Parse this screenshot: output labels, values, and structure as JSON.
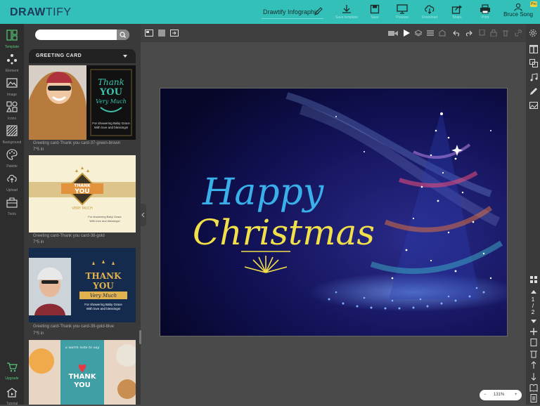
{
  "app": {
    "logo_main": "DRAW",
    "logo_tail": "TIFY",
    "doc_title": "Drawtify Infographic"
  },
  "toolbar": [
    {
      "label": "Save template",
      "icon": "download-icon"
    },
    {
      "label": "Save",
      "icon": "save-icon"
    },
    {
      "label": "Preview",
      "icon": "monitor-icon"
    },
    {
      "label": "Download",
      "icon": "cloud-download-icon"
    },
    {
      "label": "Share",
      "icon": "share-icon"
    },
    {
      "label": "Print",
      "icon": "print-icon"
    }
  ],
  "user": {
    "name": "Bruce Song",
    "badge": "Pro"
  },
  "left_nav": [
    {
      "label": "Template",
      "icon": "template-icon",
      "active": true
    },
    {
      "label": "Element",
      "icon": "element-icon",
      "active": false
    },
    {
      "label": "Image",
      "icon": "image-icon",
      "active": false
    },
    {
      "label": "Icons",
      "icon": "icons-icon",
      "active": false
    },
    {
      "label": "Background",
      "icon": "background-icon",
      "active": false
    },
    {
      "label": "Palette",
      "icon": "palette-icon",
      "active": false
    },
    {
      "label": "Upload",
      "icon": "upload-icon",
      "active": false
    },
    {
      "label": "Tools",
      "icon": "tools-icon",
      "active": false
    }
  ],
  "left_nav_bottom": [
    {
      "label": "Upgrade",
      "icon": "cart-icon"
    },
    {
      "label": "Tutorial",
      "icon": "tutorial-icon"
    }
  ],
  "panel": {
    "search_placeholder": "",
    "category": "GREETING CARD",
    "templates": [
      {
        "name": "Greeting card-Thank you card-37-green-brown",
        "size": "7*5 in",
        "t1": "Thank",
        "t2": "YOU",
        "t3": "Very Much",
        "t4": "For showering Baby Grace",
        "t5": "With love and blessings!"
      },
      {
        "name": "Greeting card-Thank you card-38-gold",
        "size": "7*5 in",
        "t1": "THANK",
        "t2": "YOU",
        "t3": "VERY MUCH",
        "t4": "For showering Baby Grace",
        "t5": "With love and blessings!"
      },
      {
        "name": "Greeting card-Thank you card-39-gold-blue",
        "size": "7*5 in",
        "t1": "THANK",
        "t2": "YOU",
        "t3": "Very Much",
        "t4": "For showering Baby Grace",
        "t5": "With love and blessings!"
      },
      {
        "name": "",
        "size": "",
        "t1": "a warm note to say",
        "t2": "THANK",
        "t3": "YOU"
      }
    ]
  },
  "canvas": {
    "headline_1": "Happy",
    "headline_2": "Christmas",
    "bg_color": "#0d0b3d",
    "happy_color": "#3ab0ea",
    "christmas_color": "#f2e04a"
  },
  "pager": {
    "current": "1",
    "sep": "/",
    "total": "2"
  },
  "zoom": {
    "minus": "−",
    "value": "131%",
    "plus": "+"
  },
  "colors": {
    "accent": "#33c0b8",
    "active_nav": "#57c778"
  }
}
